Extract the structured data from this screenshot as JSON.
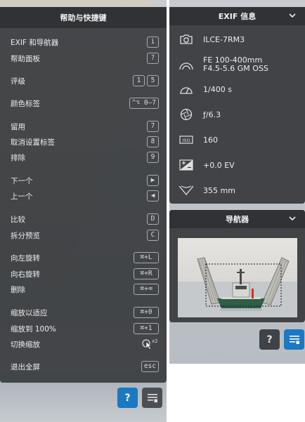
{
  "help_panel": {
    "title": "帮助与快捷键",
    "rows": [
      {
        "label": "EXIF 和导航器",
        "keys": [
          "i"
        ]
      },
      {
        "label": "帮助面板",
        "keys": [
          "?"
        ]
      },
      {
        "label": "评级",
        "keys": [
          "1",
          "5"
        ]
      },
      {
        "label": "颜色标签",
        "keys": [
          "^⌥ 0–7"
        ]
      },
      {
        "label": "留用",
        "keys": [
          "7"
        ]
      },
      {
        "label": "取消设置标签",
        "keys": [
          "8"
        ]
      },
      {
        "label": "排除",
        "keys": [
          "9"
        ]
      },
      {
        "label": "下一个",
        "keys": [
          "▶"
        ]
      },
      {
        "label": "上一个",
        "keys": [
          "◀"
        ]
      },
      {
        "label": "比较",
        "keys": [
          "D"
        ]
      },
      {
        "label": "拆分预览",
        "keys": [
          "C"
        ]
      },
      {
        "label": "向左旋转",
        "keys": [
          "⌘+L"
        ]
      },
      {
        "label": "向右旋转",
        "keys": [
          "⌘+R"
        ]
      },
      {
        "label": "删除",
        "keys": [
          "⌘+⌫"
        ]
      },
      {
        "label": "缩放以适应",
        "keys": [
          "⌘+0"
        ]
      },
      {
        "label": "缩放到 100%",
        "keys": [
          "⌘+1"
        ]
      },
      {
        "label": "切换缩放",
        "keys": [
          "x2"
        ]
      },
      {
        "label": "退出全屏",
        "keys": [
          "esc"
        ]
      }
    ]
  },
  "exif_panel": {
    "title": "EXIF 信息",
    "chevron_icon": "chevron-down-icon",
    "items": [
      {
        "icon": "camera-icon",
        "value": "ILCE-7RM3"
      },
      {
        "icon": "lens-icon",
        "value": "FE 100-400mm F4.5-5.6 GM OSS"
      },
      {
        "icon": "shutter-speed-icon",
        "value": "1/400 s"
      },
      {
        "icon": "aperture-icon",
        "value": "ƒ/6.3"
      },
      {
        "icon": "iso-icon",
        "value": "160"
      },
      {
        "icon": "exposure-compensation-icon",
        "value": "+0.0 EV"
      },
      {
        "icon": "focal-length-icon",
        "value": "355 mm"
      }
    ]
  },
  "navigator_panel": {
    "title": "导航器",
    "chevron_icon": "chevron-down-icon"
  },
  "buttons": {
    "help_label": "?",
    "list_icon": "list-view-icon"
  },
  "colors": {
    "panel_bg": "#3a3c3f",
    "accent_blue": "#1b78c2"
  }
}
